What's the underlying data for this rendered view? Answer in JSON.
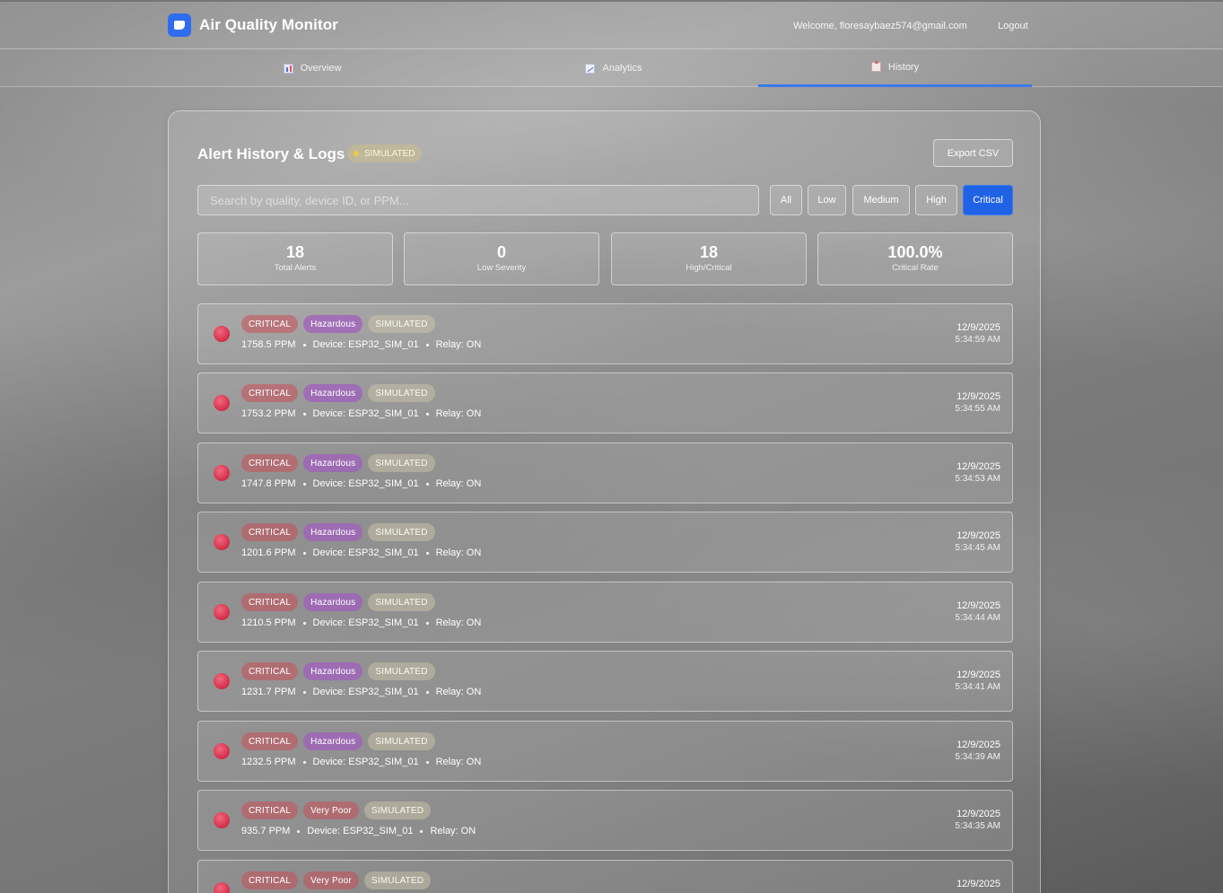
{
  "header": {
    "title": "Air Quality Monitor",
    "welcome": "Welcome, floresaybaez574@gmail.com",
    "logout": "Logout"
  },
  "tabs": [
    {
      "label": "Overview",
      "icon": "chart-bars-icon",
      "active": false
    },
    {
      "label": "Analytics",
      "icon": "trend-chart-icon",
      "active": false
    },
    {
      "label": "History",
      "icon": "clipboard-icon",
      "active": true
    }
  ],
  "panel": {
    "title": "Alert History & Logs",
    "simulated_badge": "SIMULATED",
    "export_label": "Export CSV"
  },
  "search": {
    "placeholder": "Search by quality, device ID, or PPM...",
    "value": ""
  },
  "filters": [
    {
      "label": "All",
      "active": false
    },
    {
      "label": "Low",
      "active": false
    },
    {
      "label": "Medium",
      "active": false
    },
    {
      "label": "High",
      "active": false
    },
    {
      "label": "Critical",
      "active": true
    }
  ],
  "stats": [
    {
      "value": "18",
      "label": "Total Alerts"
    },
    {
      "value": "0",
      "label": "Low Severity"
    },
    {
      "value": "18",
      "label": "High/Critical"
    },
    {
      "value": "100.0%",
      "label": "Critical Rate"
    }
  ],
  "alerts": [
    {
      "severity": "CRITICAL",
      "quality": "Hazardous",
      "source": "SIMULATED",
      "ppm": "1758.5 PPM",
      "device": "Device: ESP32_SIM_01",
      "relay": "Relay: ON",
      "date": "12/9/2025",
      "time": "5:34:59 AM"
    },
    {
      "severity": "CRITICAL",
      "quality": "Hazardous",
      "source": "SIMULATED",
      "ppm": "1753.2 PPM",
      "device": "Device: ESP32_SIM_01",
      "relay": "Relay: ON",
      "date": "12/9/2025",
      "time": "5:34:55 AM"
    },
    {
      "severity": "CRITICAL",
      "quality": "Hazardous",
      "source": "SIMULATED",
      "ppm": "1747.8 PPM",
      "device": "Device: ESP32_SIM_01",
      "relay": "Relay: ON",
      "date": "12/9/2025",
      "time": "5:34:53 AM"
    },
    {
      "severity": "CRITICAL",
      "quality": "Hazardous",
      "source": "SIMULATED",
      "ppm": "1201.6 PPM",
      "device": "Device: ESP32_SIM_01",
      "relay": "Relay: ON",
      "date": "12/9/2025",
      "time": "5:34:45 AM"
    },
    {
      "severity": "CRITICAL",
      "quality": "Hazardous",
      "source": "SIMULATED",
      "ppm": "1210.5 PPM",
      "device": "Device: ESP32_SIM_01",
      "relay": "Relay: ON",
      "date": "12/9/2025",
      "time": "5:34:44 AM"
    },
    {
      "severity": "CRITICAL",
      "quality": "Hazardous",
      "source": "SIMULATED",
      "ppm": "1231.7 PPM",
      "device": "Device: ESP32_SIM_01",
      "relay": "Relay: ON",
      "date": "12/9/2025",
      "time": "5:34:41 AM"
    },
    {
      "severity": "CRITICAL",
      "quality": "Hazardous",
      "source": "SIMULATED",
      "ppm": "1232.5 PPM",
      "device": "Device: ESP32_SIM_01",
      "relay": "Relay: ON",
      "date": "12/9/2025",
      "time": "5:34:39 AM"
    },
    {
      "severity": "CRITICAL",
      "quality": "Very Poor",
      "source": "SIMULATED",
      "ppm": "935.7 PPM",
      "device": "Device: ESP32_SIM_01",
      "relay": "Relay: ON",
      "date": "12/9/2025",
      "time": "5:34:35 AM"
    },
    {
      "severity": "CRITICAL",
      "quality": "Very Poor",
      "source": "SIMULATED",
      "ppm": "",
      "device": "",
      "relay": "",
      "date": "12/9/2025",
      "time": ""
    }
  ],
  "colors": {
    "accent": "#1f62e6",
    "critical_dot": "#d42c48",
    "hazardous_badge": "#a05fbe",
    "simulated_dot": "#f0c846"
  }
}
